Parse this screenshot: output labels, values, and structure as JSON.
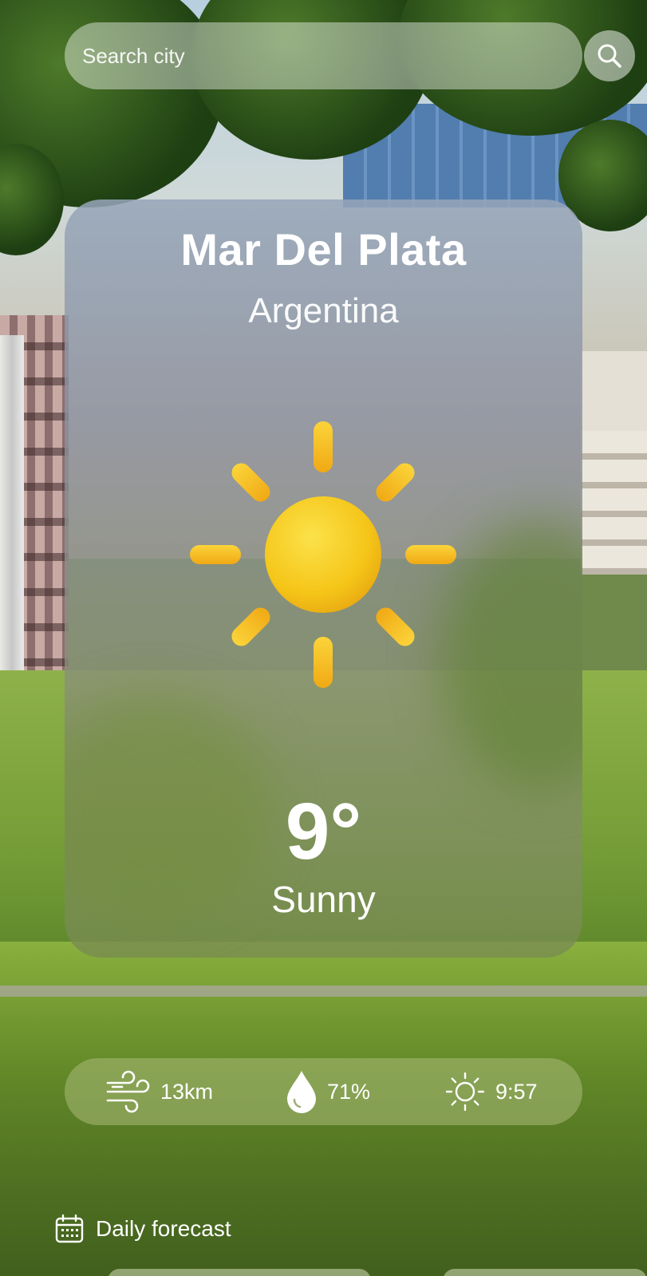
{
  "search": {
    "placeholder": "Search city"
  },
  "location": {
    "city": "Mar Del Plata",
    "country": "Argentina"
  },
  "weather": {
    "temperature": "9°",
    "condition": "Sunny",
    "icon": "sun-icon"
  },
  "stats": {
    "wind": {
      "icon": "wind-icon",
      "value": "13km"
    },
    "humidity": {
      "icon": "droplet-icon",
      "value": "71%"
    },
    "sunrise": {
      "icon": "sun-outline-icon",
      "value": "9:57"
    }
  },
  "forecast": {
    "icon": "calendar-icon",
    "label": "Daily forecast"
  },
  "colors": {
    "sun": "#F5C518",
    "text": "#FFFFFF"
  }
}
